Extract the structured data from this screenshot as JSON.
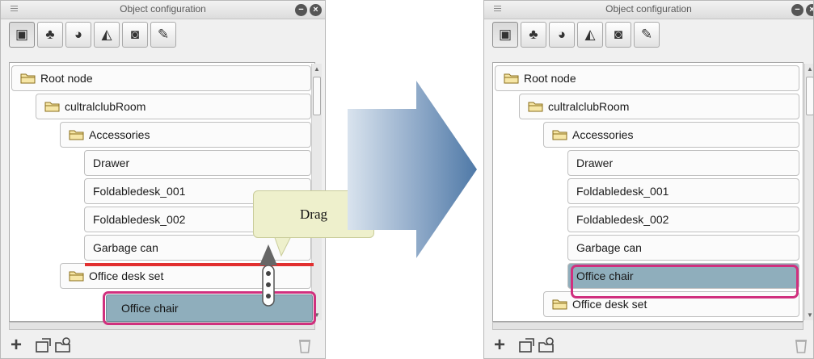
{
  "panel": {
    "title": "Object configuration",
    "toolbar": [
      "layer-view-icon",
      "tree-icon",
      "sphere-icon",
      "terrain-icon",
      "camera-icon",
      "pen-icon"
    ]
  },
  "before": {
    "nodes": [
      {
        "label": "Root node",
        "folder": true
      },
      {
        "label": "cultralclubRoom",
        "folder": true
      },
      {
        "label": "Accessories",
        "folder": true
      },
      {
        "label": "Drawer",
        "folder": false
      },
      {
        "label": "Foldabledesk_001",
        "folder": false
      },
      {
        "label": "Foldabledesk_002",
        "folder": false
      },
      {
        "label": "Garbage can",
        "folder": false
      },
      {
        "label": "Office desk set",
        "folder": true
      }
    ],
    "dragged_label": "Office chair",
    "callout": "Drag"
  },
  "after": {
    "nodes": [
      {
        "label": "Root node",
        "folder": true
      },
      {
        "label": "cultralclubRoom",
        "folder": true
      },
      {
        "label": "Accessories",
        "folder": true
      },
      {
        "label": "Drawer",
        "folder": false
      },
      {
        "label": "Foldabledesk_001",
        "folder": false
      },
      {
        "label": "Foldabledesk_002",
        "folder": false
      },
      {
        "label": "Garbage can",
        "folder": false
      },
      {
        "label": "Office chair",
        "folder": false,
        "selected": true
      },
      {
        "label": "Office desk set",
        "folder": true
      }
    ]
  },
  "colors": {
    "highlight": "#d0307e",
    "drop_line": "#e23030",
    "selected": "#8faebc",
    "arrow": "#5f87b2"
  }
}
